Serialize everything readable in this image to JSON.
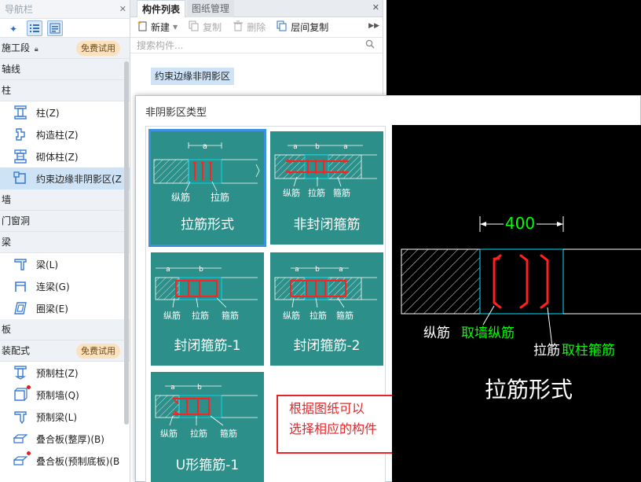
{
  "nav": {
    "title": "导航栏",
    "pin": "✕",
    "categories": {
      "stage": "施工段",
      "axis": "轴线",
      "column": "柱",
      "wall": "墙",
      "door_window": "门窗洞",
      "beam": "梁",
      "slab": "板",
      "prefab": "装配式"
    },
    "badge": "免费试用",
    "column_items": [
      "柱(Z)",
      "构造柱(Z)",
      "砌体柱(Z)",
      "约束边缘非阴影区(Z"
    ],
    "beam_items": [
      "梁(L)",
      "连梁(G)",
      "圈梁(E)"
    ],
    "prefab_items": [
      "预制柱(Z)",
      "预制墙(Q)",
      "预制梁(L)",
      "叠合板(整厚)(B)",
      "叠合板(预制底板)(B"
    ]
  },
  "panel": {
    "tab_active": "构件列表",
    "tab_other": "图纸管理",
    "close": "✕",
    "toolbar": {
      "new": "新建",
      "copy": "复制",
      "delete": "删除",
      "floor_copy": "层间复制"
    },
    "search_placeholder": "搜索构件...",
    "selected_component": "约束边缘非阴影区"
  },
  "dialog": {
    "title": "非阴影区类型",
    "cards": [
      {
        "title": "拉筋形式",
        "dim": "a",
        "labels": [
          "纵筋",
          "拉筋"
        ]
      },
      {
        "title": "非封闭箍筋",
        "dims": [
          "a",
          "b",
          "a"
        ],
        "labels": [
          "纵筋",
          "拉筋",
          "箍筋"
        ]
      },
      {
        "title": "封闭箍筋-1",
        "dims": [
          "a",
          "b"
        ],
        "labels": [
          "纵筋",
          "拉筋",
          "箍筋"
        ]
      },
      {
        "title": "封闭箍筋-2",
        "dims": [
          "a",
          "b",
          "a"
        ],
        "labels": [
          "纵筋",
          "拉筋",
          "箍筋"
        ]
      },
      {
        "title": "U形箍筋-1",
        "dims": [
          "a",
          "b"
        ],
        "labels": [
          "纵筋",
          "拉筋",
          "箍筋"
        ]
      }
    ],
    "note": [
      "根据图纸可以",
      "选择相应的构件"
    ],
    "preview": {
      "dimension": "400",
      "label_long_rebar": "纵筋",
      "label_long_rebar_note": "取墙纵筋",
      "label_tie": "拉筋",
      "label_tie_note": "取柱箍筋",
      "caption": "拉筋形式"
    }
  },
  "colors": {
    "card_bg": "#2c8f89",
    "rebar_red": "#ff2020",
    "cad_green": "#00ff00",
    "cad_cyan": "#00e5ff",
    "badge_bg": "#fbe1bd",
    "selection_blue": "#3d8fe0",
    "note_red": "#e8262a"
  }
}
